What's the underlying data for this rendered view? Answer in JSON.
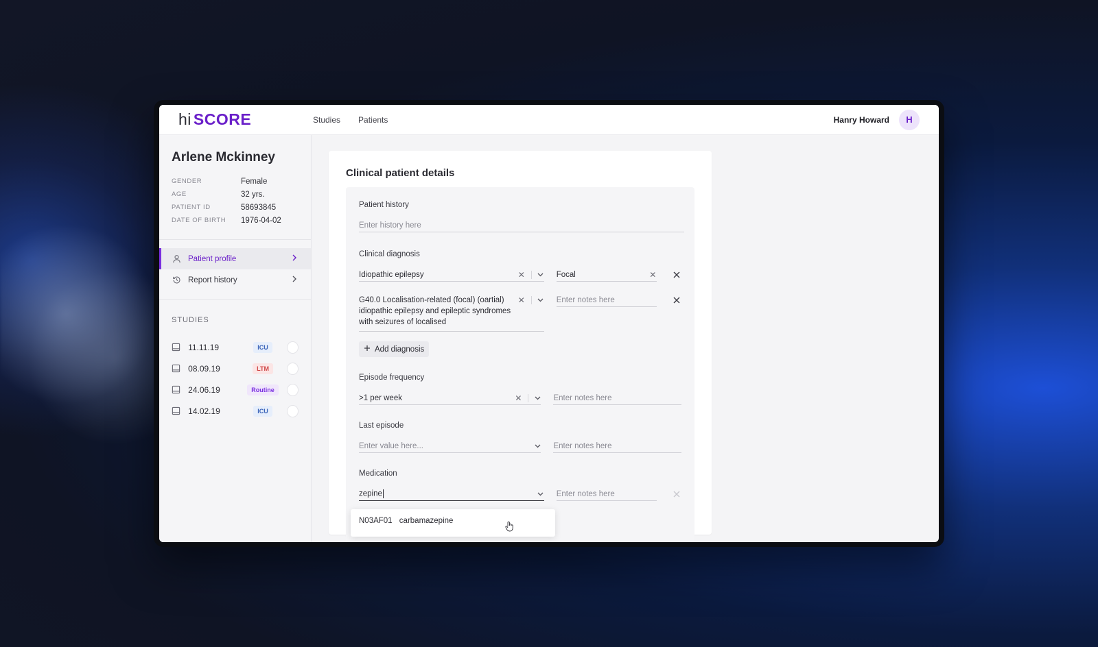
{
  "app": {
    "logo_hi": "hi",
    "logo_score": "SCORE",
    "nav": [
      "Studies",
      "Patients"
    ],
    "user_name": "Hanry Howard",
    "user_initial": "H"
  },
  "patient": {
    "name": "Arlene Mckinney",
    "info": [
      {
        "label": "GENDER",
        "value": "Female"
      },
      {
        "label": "AGE",
        "value": "32 yrs."
      },
      {
        "label": "PATIENT ID",
        "value": "58693845"
      },
      {
        "label": "DATE OF BIRTH",
        "value": "1976-04-02"
      }
    ]
  },
  "menu": {
    "items": [
      {
        "label": "Patient profile",
        "icon": "user-icon",
        "active": true
      },
      {
        "label": "Report history",
        "icon": "history-icon",
        "active": false
      }
    ]
  },
  "studies": {
    "title": "STUDIES",
    "items": [
      {
        "date": "11.11.19",
        "badge": "ICU",
        "badge_type": "icu"
      },
      {
        "date": "08.09.19",
        "badge": "LTM",
        "badge_type": "ltm"
      },
      {
        "date": "24.06.19",
        "badge": "Routine",
        "badge_type": "routine"
      },
      {
        "date": "14.02.19",
        "badge": "ICU",
        "badge_type": "icu"
      }
    ]
  },
  "form": {
    "title": "Clinical patient details",
    "patient_history": {
      "label": "Patient history",
      "placeholder": "Enter history here"
    },
    "clinical_diagnosis": {
      "label": "Clinical diagnosis",
      "rows": [
        {
          "value": "Idiopathic epilepsy",
          "notes": "Focal"
        },
        {
          "value": "G40.0 Localisation-related (focal) (oartial) idiopathic epilepsy and epileptic syndromes with seizures of localised",
          "notes_placeholder": "Enter notes here"
        }
      ],
      "add_label": "Add diagnosis"
    },
    "episode_frequency": {
      "label": "Episode frequency",
      "value": ">1 per week",
      "notes_placeholder": "Enter notes here"
    },
    "last_episode": {
      "label": "Last episode",
      "placeholder": "Enter value here...",
      "notes_placeholder": "Enter notes here"
    },
    "medication": {
      "label": "Medication",
      "value": "zepine",
      "notes_placeholder": "Enter notes here",
      "suggestion": {
        "code": "N03AF01",
        "name": "carbamazepine"
      }
    }
  },
  "colors": {
    "accent": "#6a1fc9",
    "icu": "#3a63b8",
    "ltm": "#d04848",
    "routine": "#7a2fe0"
  }
}
